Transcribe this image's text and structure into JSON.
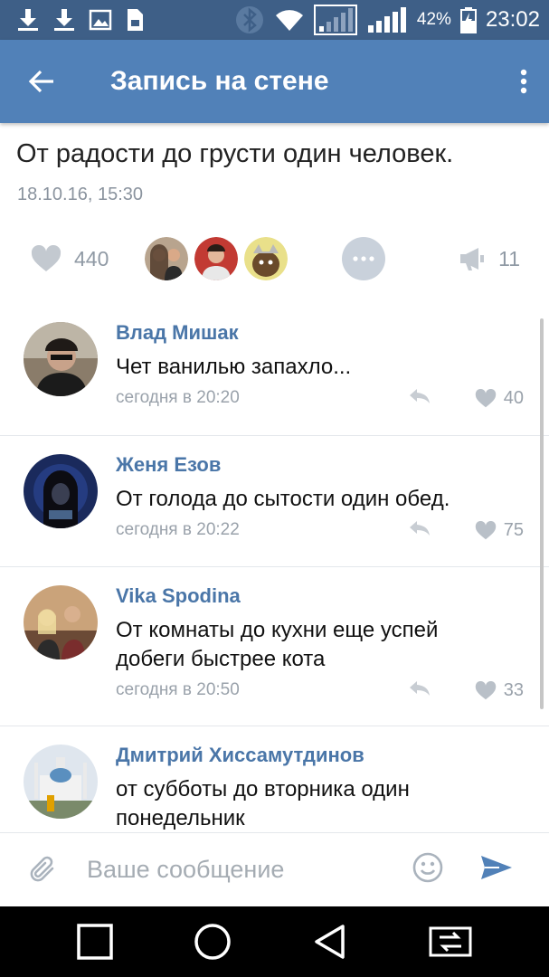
{
  "status_bar": {
    "battery": "42%",
    "time": "23:02",
    "icons": [
      "download-icon",
      "download-icon",
      "image-icon",
      "screenshot-icon",
      "bluetooth-icon",
      "wifi-icon",
      "signal-icon",
      "signal-icon",
      "battery-charging-icon"
    ]
  },
  "toolbar": {
    "title": "Запись на стене",
    "back_icon": "arrow-left-icon",
    "menu_icon": "more-vertical-icon"
  },
  "post": {
    "text": "От радости до грусти один человек.",
    "date": "18.10.16, 15:30",
    "likes": "440",
    "reposts": "11"
  },
  "comments": [
    {
      "author": "Влад Мишак",
      "text": "Чет ванилью запахло...",
      "date": "сегодня в 20:20",
      "likes": "40"
    },
    {
      "author": "Женя Езов",
      "text": "От голода до сытости один обед.",
      "date": "сегодня в 20:22",
      "likes": "75"
    },
    {
      "author": "Vika Spodina",
      "text": "От комнаты до кухни еще успей добеги быстрее кота",
      "date": "сегодня в 20:50",
      "likes": "33"
    },
    {
      "author": "Дмитрий Хиссамутдинов",
      "text": "от субботы до вторника один понедельник",
      "date": "",
      "likes": ""
    }
  ],
  "composer": {
    "placeholder": "Ваше сообщение"
  },
  "colors": {
    "status_bar": "#3e5f87",
    "toolbar": "#5181b8",
    "author": "#4a76a8",
    "muted": "#909aa5"
  }
}
